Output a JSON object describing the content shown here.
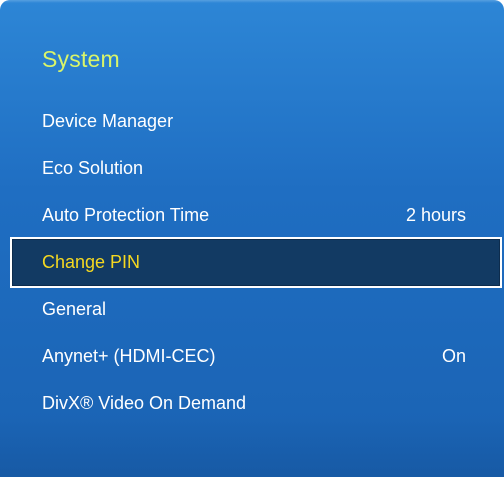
{
  "menu": {
    "title": "System",
    "items": [
      {
        "label": "Device Manager",
        "value": ""
      },
      {
        "label": "Eco Solution",
        "value": ""
      },
      {
        "label": "Auto Protection Time",
        "value": "2 hours"
      },
      {
        "label": "Change PIN",
        "value": ""
      },
      {
        "label": "General",
        "value": ""
      },
      {
        "label": "Anynet+ (HDMI-CEC)",
        "value": "On"
      },
      {
        "label": "DivX® Video On Demand",
        "value": ""
      }
    ],
    "selected_label": "Change PIN"
  },
  "colors": {
    "panel_blue": "#1f6ec2",
    "title_green": "#d9f56a",
    "selected_background": "#123a63",
    "selected_text": "#f5d820",
    "item_text": "#ffffff"
  }
}
